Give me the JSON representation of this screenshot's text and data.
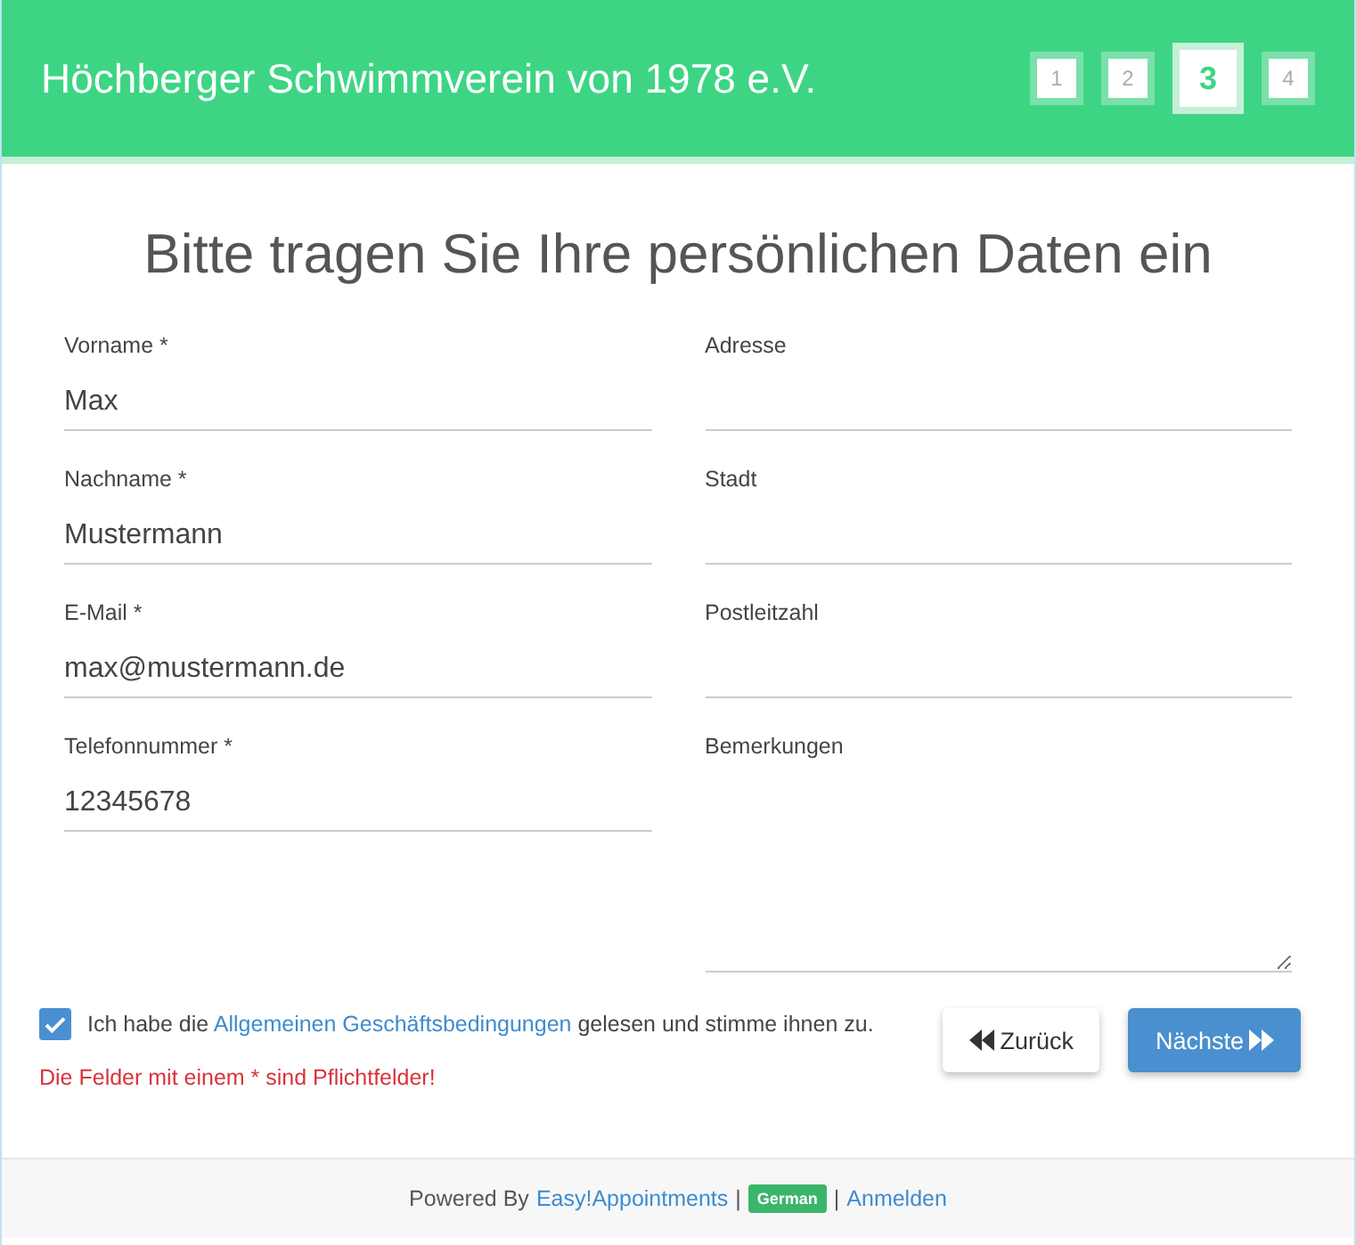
{
  "header": {
    "title": "Höchberger Schwimmverein von 1978 e.V.",
    "steps": [
      {
        "label": "1",
        "selected": false
      },
      {
        "label": "2",
        "selected": false
      },
      {
        "label": "3",
        "selected": true
      },
      {
        "label": "4",
        "selected": false
      }
    ]
  },
  "heading": "Bitte tragen Sie Ihre persönlichen Daten ein",
  "left_fields": [
    {
      "label": "Vorname *",
      "value": "Max"
    },
    {
      "label": "Nachname *",
      "value": "Mustermann"
    },
    {
      "label": "E-Mail *",
      "value": "max@mustermann.de"
    },
    {
      "label": "Telefonnummer *",
      "value": "12345678"
    }
  ],
  "right_fields": [
    {
      "label": "Adresse",
      "kind": "input"
    },
    {
      "label": "Stadt",
      "kind": "input"
    },
    {
      "label": "Postleitzahl",
      "kind": "input"
    },
    {
      "label": "Bemerkungen",
      "kind": "textarea"
    }
  ],
  "terms": {
    "checked": true,
    "before": "Ich habe die ",
    "link": "Allgemeinen Geschäftsbedingungen",
    "after": " gelesen und stimme ihnen zu."
  },
  "required_note": "Die Felder mit einem * sind Pflichtfelder!",
  "buttons": {
    "back": "Zurück",
    "next": "Nächste"
  },
  "footer": {
    "powered": "Powered By",
    "link": "Easy!Appointments",
    "separator_1": "|",
    "language": "German",
    "separator_2": "|",
    "login": "Anmelden"
  }
}
